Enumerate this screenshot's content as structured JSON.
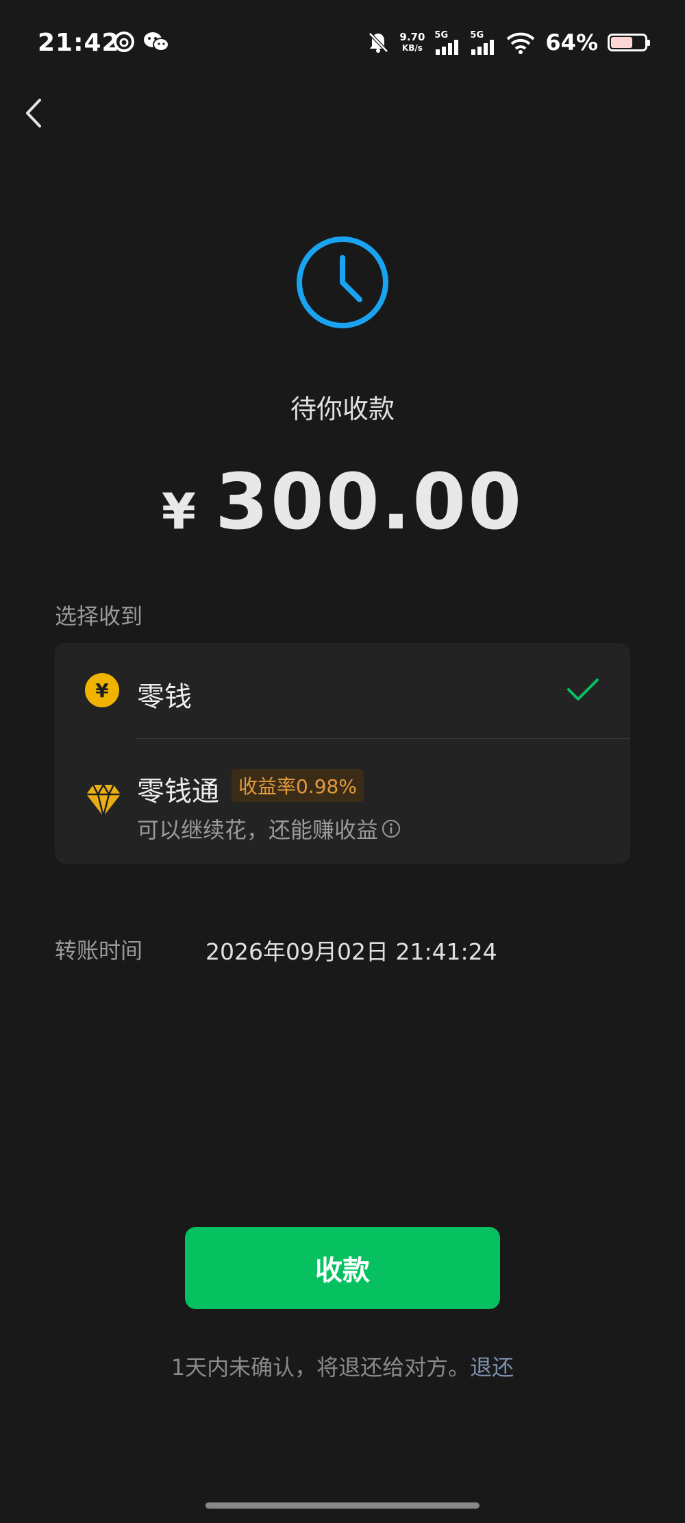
{
  "status_bar": {
    "time": "21:42",
    "net_speed_value": "9.70",
    "net_speed_unit": "KB/s",
    "signal1_label": "5G",
    "signal2_label": "5G",
    "battery_percent": "64%",
    "battery_level": 0.64
  },
  "page": {
    "status_title": "待你收款",
    "currency_symbol": "¥",
    "amount": "300.00"
  },
  "receive_section": {
    "label": "选择收到",
    "options": [
      {
        "label": "零钱",
        "icon": "yuan-coin-icon",
        "selected": true
      },
      {
        "label": "零钱通",
        "icon": "diamond-icon",
        "badge": "收益率0.98%",
        "subtitle": "可以继续花，还能赚收益",
        "selected": false
      }
    ]
  },
  "transfer_time": {
    "label": "转账时间",
    "value": "2026年09月02日 21:41:24"
  },
  "actions": {
    "receive_button": "收款"
  },
  "notice": {
    "text": "1天内未确认，将退还给对方。",
    "link": "退还"
  },
  "colors": {
    "background": "#191919",
    "card": "#232323",
    "accent_green": "#07c160",
    "clock_blue": "#1aa3f0",
    "coin_gold": "#f0b400",
    "badge_orange": "#e39a3d",
    "link_blue": "#7d90b0"
  }
}
